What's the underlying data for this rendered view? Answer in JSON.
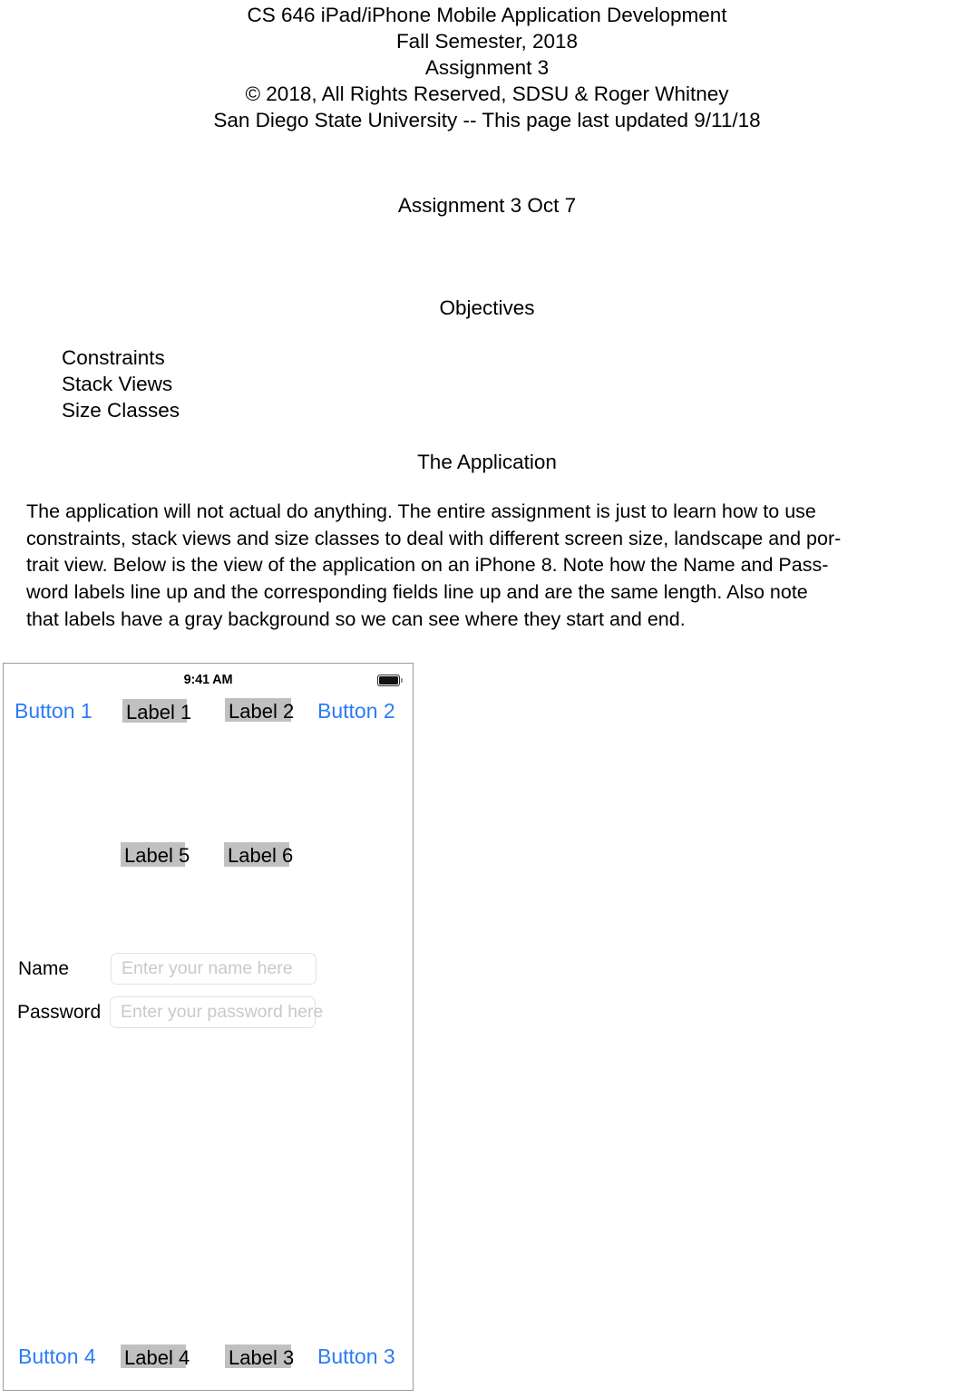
{
  "document": {
    "header_lines": [
      "CS 646 iPad/iPhone Mobile Application Development",
      "Fall Semester, 2018",
      "Assignment 3",
      "© 2018, All Rights Reserved, SDSU & Roger Whitney",
      "San Diego State University -- This page last updated 9/11/18"
    ],
    "assignment_title": "Assignment 3",
    "assignment_due": "Oct 7",
    "objectives_heading": "Objectives",
    "objectives": [
      "Constraints",
      "Stack Views",
      "Size Classes"
    ],
    "application_heading": "The Application",
    "paragraph_lines": [
      "The application will not actual do anything. The entire assignment is just to learn how to use",
      "constraints, stack views and size classes to deal with different screen size, landscape and por-",
      "trait view. Below is the view of the application on an iPhone 8. Note how the Name and Pass-",
      "word labels line up and the corresponding fields line up and are the same length. Also note",
      "that labels have a gray background so we can see where they start and end."
    ]
  },
  "phone": {
    "status_bar": {
      "time": "9:41 AM",
      "battery_icon": "battery-full-icon"
    },
    "top_row": {
      "button_left": "Button 1",
      "label_left": "Label 1",
      "label_right": "Label 2",
      "button_right": "Button 2"
    },
    "middle_row": {
      "label_left": "Label 5",
      "label_right": "Label 6"
    },
    "form": {
      "name_label": "Name",
      "name_placeholder": "Enter your name here",
      "name_value": "",
      "password_label": "Password",
      "password_placeholder": "Enter your password here",
      "password_value": ""
    },
    "bottom_row": {
      "button_left": "Button 4",
      "label_left": "Label 4",
      "label_right": "Label 3",
      "button_right": "Button 3"
    },
    "colors": {
      "button_blue": "#2b7cf7",
      "label_gray": "#c0c0c0",
      "field_border": "#e2e2e2",
      "placeholder_gray": "#c9c9cc",
      "frame_border": "#9a9a9a"
    }
  }
}
